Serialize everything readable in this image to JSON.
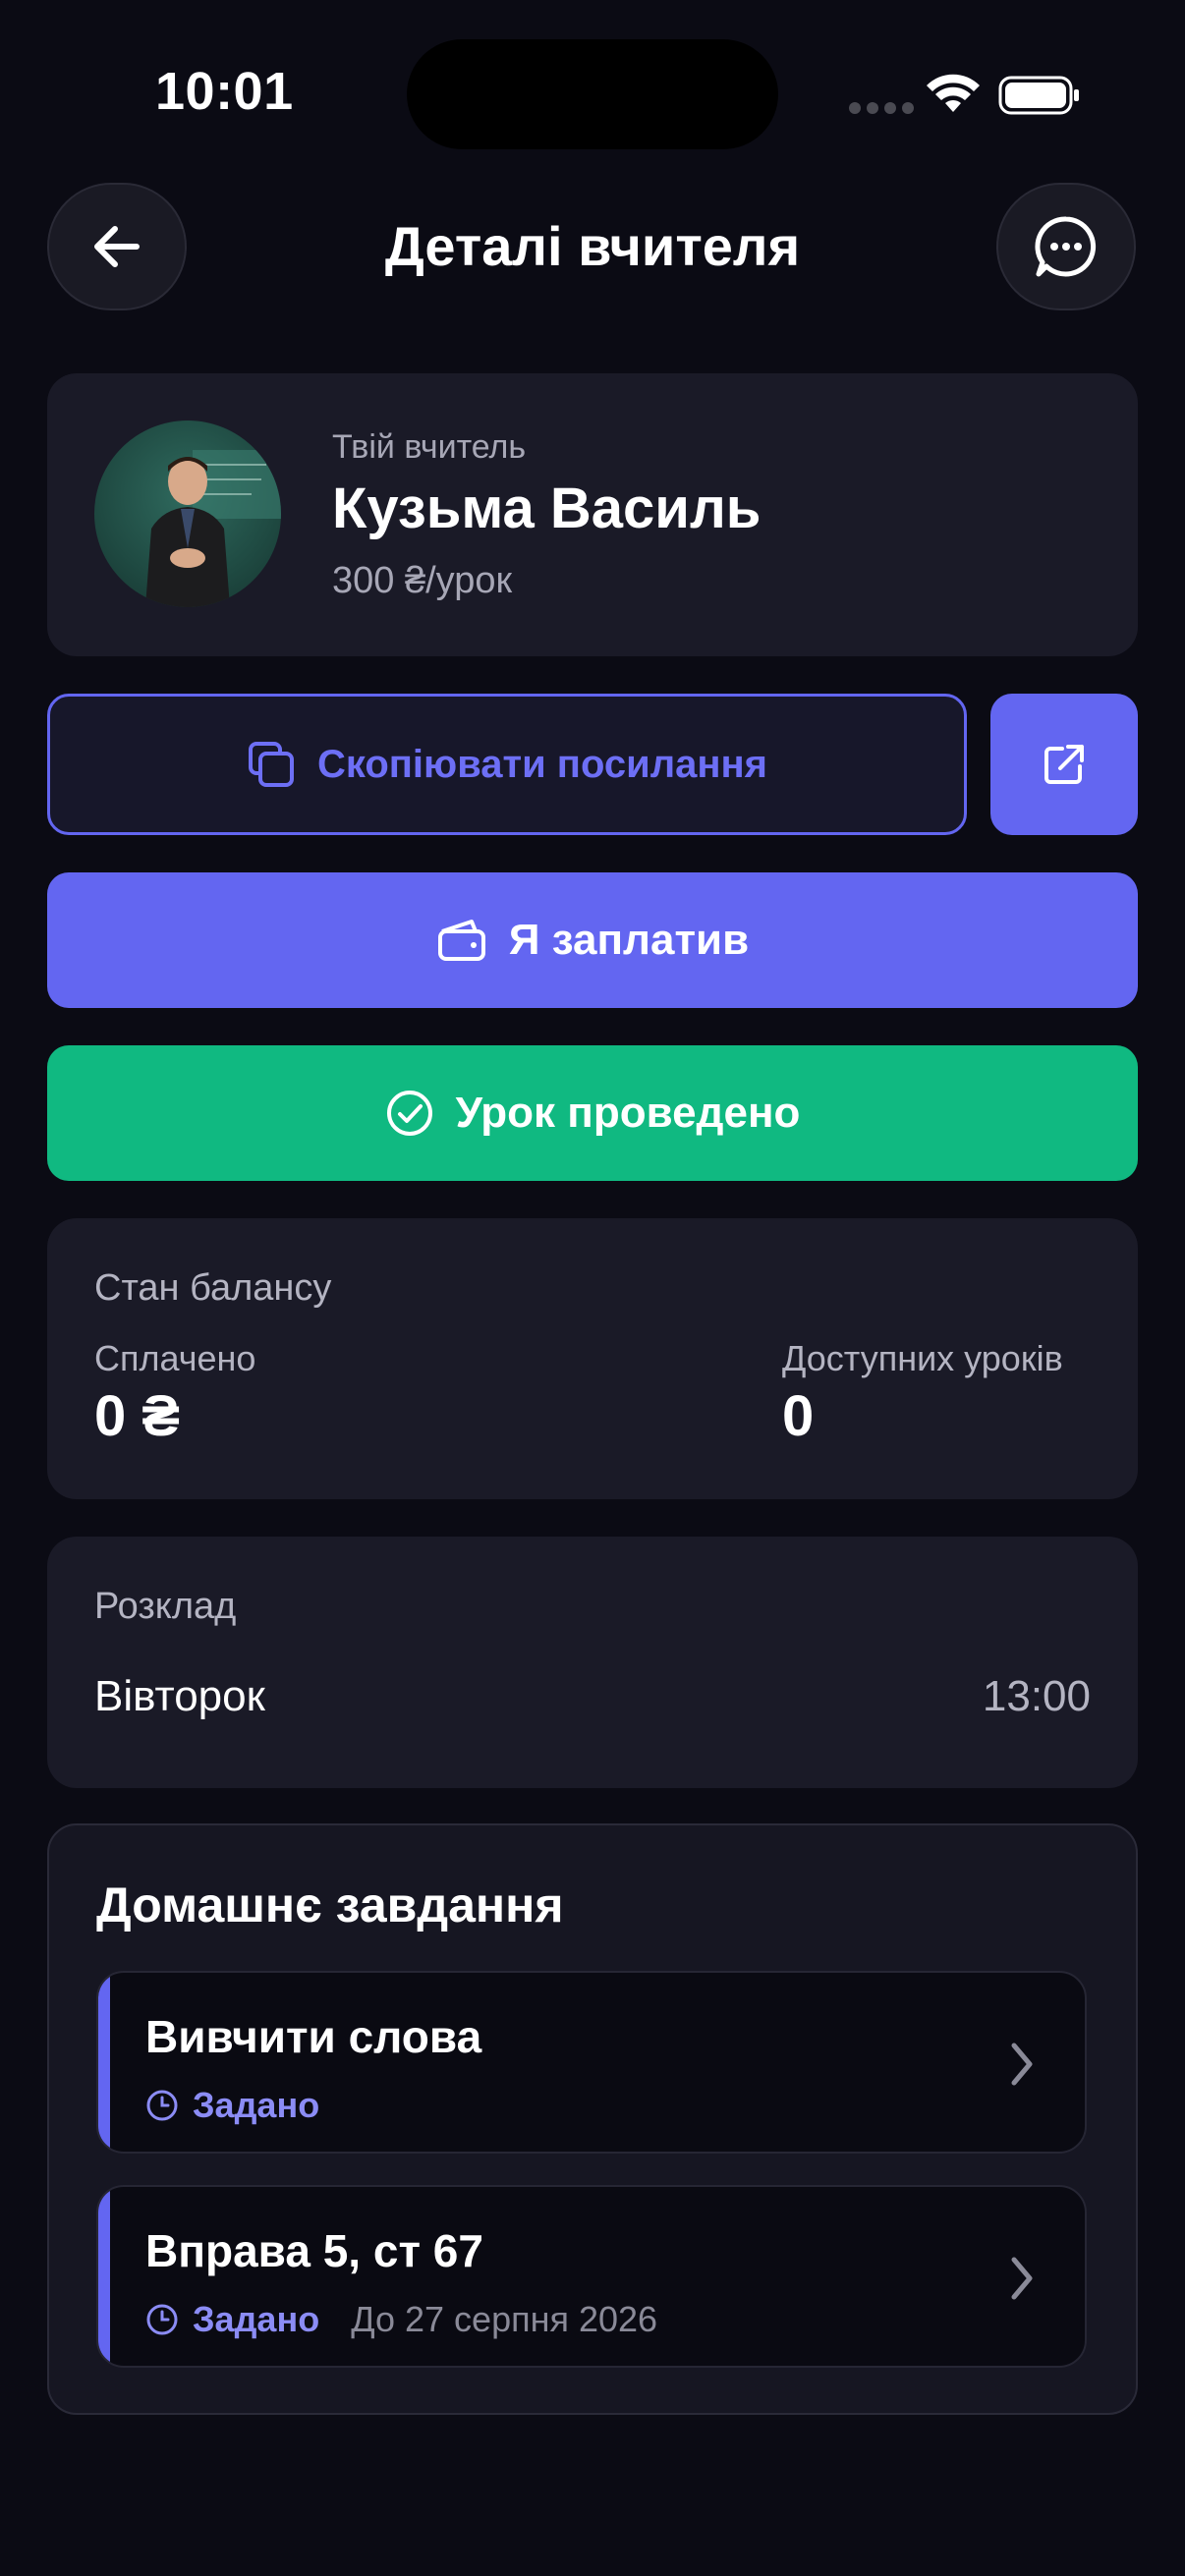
{
  "status_bar": {
    "time": "10:01"
  },
  "header": {
    "title": "Деталі вчителя"
  },
  "teacher": {
    "subtitle": "Твій вчитель",
    "name": "Кузьма Василь",
    "price": "300 ₴/урок"
  },
  "actions": {
    "copy_link_label": "Скопіювати посилання",
    "paid_label": "Я заплатив",
    "lesson_done_label": "Урок проведено"
  },
  "balance": {
    "title": "Стан балансу",
    "paid_label": "Сплачено",
    "paid_value": "0 ₴",
    "available_label": "Доступних уроків",
    "available_value": "0"
  },
  "schedule": {
    "title": "Розклад",
    "day": "Вівторок",
    "time": "13:00"
  },
  "homework": {
    "title": "Домашнє завдання",
    "items": [
      {
        "name": "Вивчити слова",
        "status": "Задано",
        "due": ""
      },
      {
        "name": "Вправа 5, ст 67",
        "status": "Задано",
        "due": "До 27 серпня 2026"
      }
    ]
  },
  "colors": {
    "background": "#0b0b14",
    "card": "#1a1a27",
    "accent": "#6366f1",
    "success": "#10b981"
  }
}
